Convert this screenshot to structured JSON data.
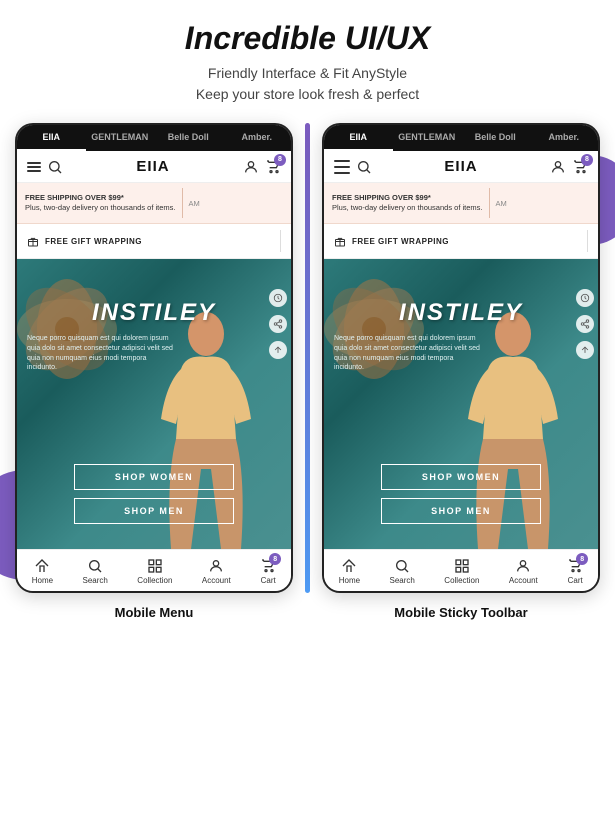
{
  "header": {
    "title": "Incredible UI/UX",
    "subtitle_line1": "Friendly Interface & Fit AnyStyle",
    "subtitle_line2": "Keep your store look fresh & perfect"
  },
  "phones": [
    {
      "id": "mobile-menu",
      "caption": "Mobile Menu",
      "nav_tabs": [
        "EIIA",
        "GENTLEMAN",
        "Belle Doll",
        "Amber."
      ],
      "active_tab": "EIIA",
      "brand": "EIIA",
      "shipping_text_bold": "FREE SHIPPING OVER $99*",
      "shipping_text_small": "Plus, two-day delivery on thousands of items.",
      "shipping_overflow": "AM",
      "gift_label": "FREE GIFT WRAPPING",
      "hero_title": "INSTILEY",
      "hero_body": "Neque porro quisquam est qui dolorem ipsum quia dolo sit amet consectetur adipisci velit sed quia non numquam eius modi tempora incidunto.",
      "btn_women": "SHOP WOMEN",
      "btn_men": "SHOP MEN",
      "cart_count": "8",
      "bottom_nav": [
        "Home",
        "Search",
        "Collection",
        "Account",
        "Cart"
      ],
      "has_hamburger": true
    },
    {
      "id": "mobile-sticky",
      "caption": "Mobile Sticky Toolbar",
      "nav_tabs": [
        "EIIA",
        "GENTLEMAN",
        "Belle Doll",
        "Amber."
      ],
      "active_tab": "EIIA",
      "brand": "EIIA",
      "shipping_text_bold": "FREE SHIPPING OVER $99*",
      "shipping_text_small": "Plus, two-day delivery on thousands of items.",
      "shipping_overflow": "AM",
      "gift_label": "FREE GIFT WRAPPING",
      "hero_title": "INSTILEY",
      "hero_body": "Neque porro quisquam est qui dolorem ipsum quia dolo sit amet consectetur adipisci velit sed quia non numquam eius modi tempora incidunto.",
      "btn_women": "SHOP WOMEN",
      "btn_men": "SHOP MEN",
      "cart_count": "8",
      "bottom_nav": [
        "Home",
        "Search",
        "Collection",
        "Account",
        "Cart"
      ],
      "has_hamburger": false
    }
  ]
}
